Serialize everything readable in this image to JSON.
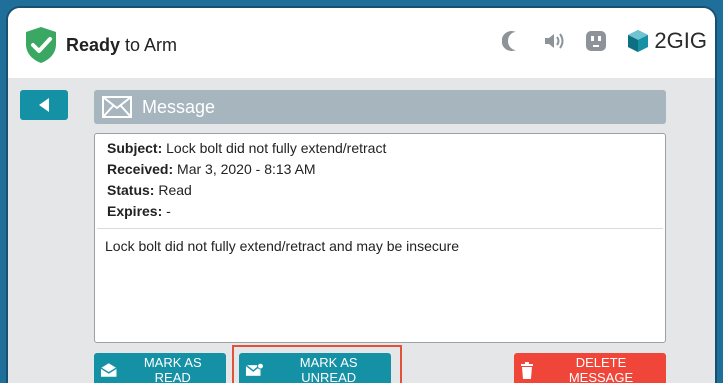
{
  "status": {
    "bold": "Ready",
    "rest": " to Arm"
  },
  "brand": {
    "logo_text": "2GIG"
  },
  "tray_icons": [
    "moon-icon",
    "speaker-icon",
    "outlet-icon"
  ],
  "header": {
    "title": "Message"
  },
  "message": {
    "subject_label": "Subject:",
    "subject": "Lock bolt did not fully extend/retract",
    "received_label": "Received:",
    "received": "Mar 3, 2020 - 8:13 AM",
    "status_label": "Status:",
    "status": "Read",
    "expires_label": "Expires:",
    "expires": "-",
    "body": "Lock bolt did not fully extend/retract and may be insecure"
  },
  "actions": {
    "mark_read": "MARK AS READ",
    "mark_unread": "MARK AS UNREAD",
    "delete": "DELETE MESSAGE"
  },
  "colors": {
    "accent": "#1591a6",
    "danger": "#f0463a",
    "shield": "#3aa862",
    "highlight": "#e2513a"
  }
}
